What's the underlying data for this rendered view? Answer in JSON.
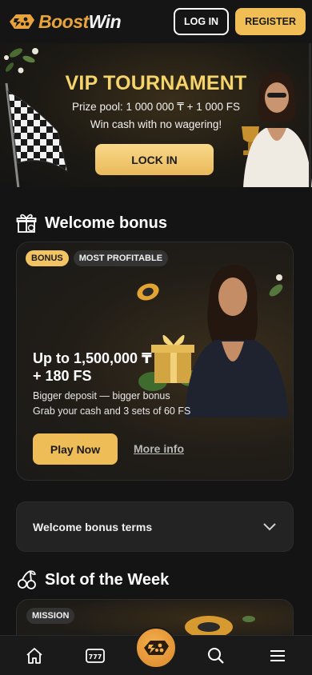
{
  "header": {
    "logo_text_1": "Boost",
    "logo_text_2": "Win",
    "login_label": "LOG IN",
    "register_label": "REGISTER"
  },
  "hero": {
    "title": "VIP TOURNAMENT",
    "line1": "Prize pool: 1 000 000 ₸ + 1 000 FS",
    "line2": "Win cash with no wagering!",
    "cta": "LOCK IN"
  },
  "welcome": {
    "heading": "Welcome bonus",
    "tags": [
      "BONUS",
      "MOST PROFITABLE"
    ],
    "title_line1": "Up to 1,500,000 ₸",
    "title_line2": "+ 180 FS",
    "desc1": "Bigger deposit — bigger bonus",
    "desc2": "Grab your cash and 3 sets of 60 FS",
    "play_label": "Play Now",
    "more_label": "More info"
  },
  "terms": {
    "label": "Welcome bonus terms"
  },
  "slot": {
    "heading": "Slot of the Week",
    "tag": "MISSION"
  },
  "nav": {
    "items": [
      "home-icon",
      "slots-777-icon",
      "boostwin-logo-icon",
      "search-icon",
      "menu-icon"
    ]
  },
  "colors": {
    "accent_gold": "#f1be55",
    "hero_title": "#f6d46c",
    "background": "#141414",
    "card": "#1f1d1b"
  }
}
